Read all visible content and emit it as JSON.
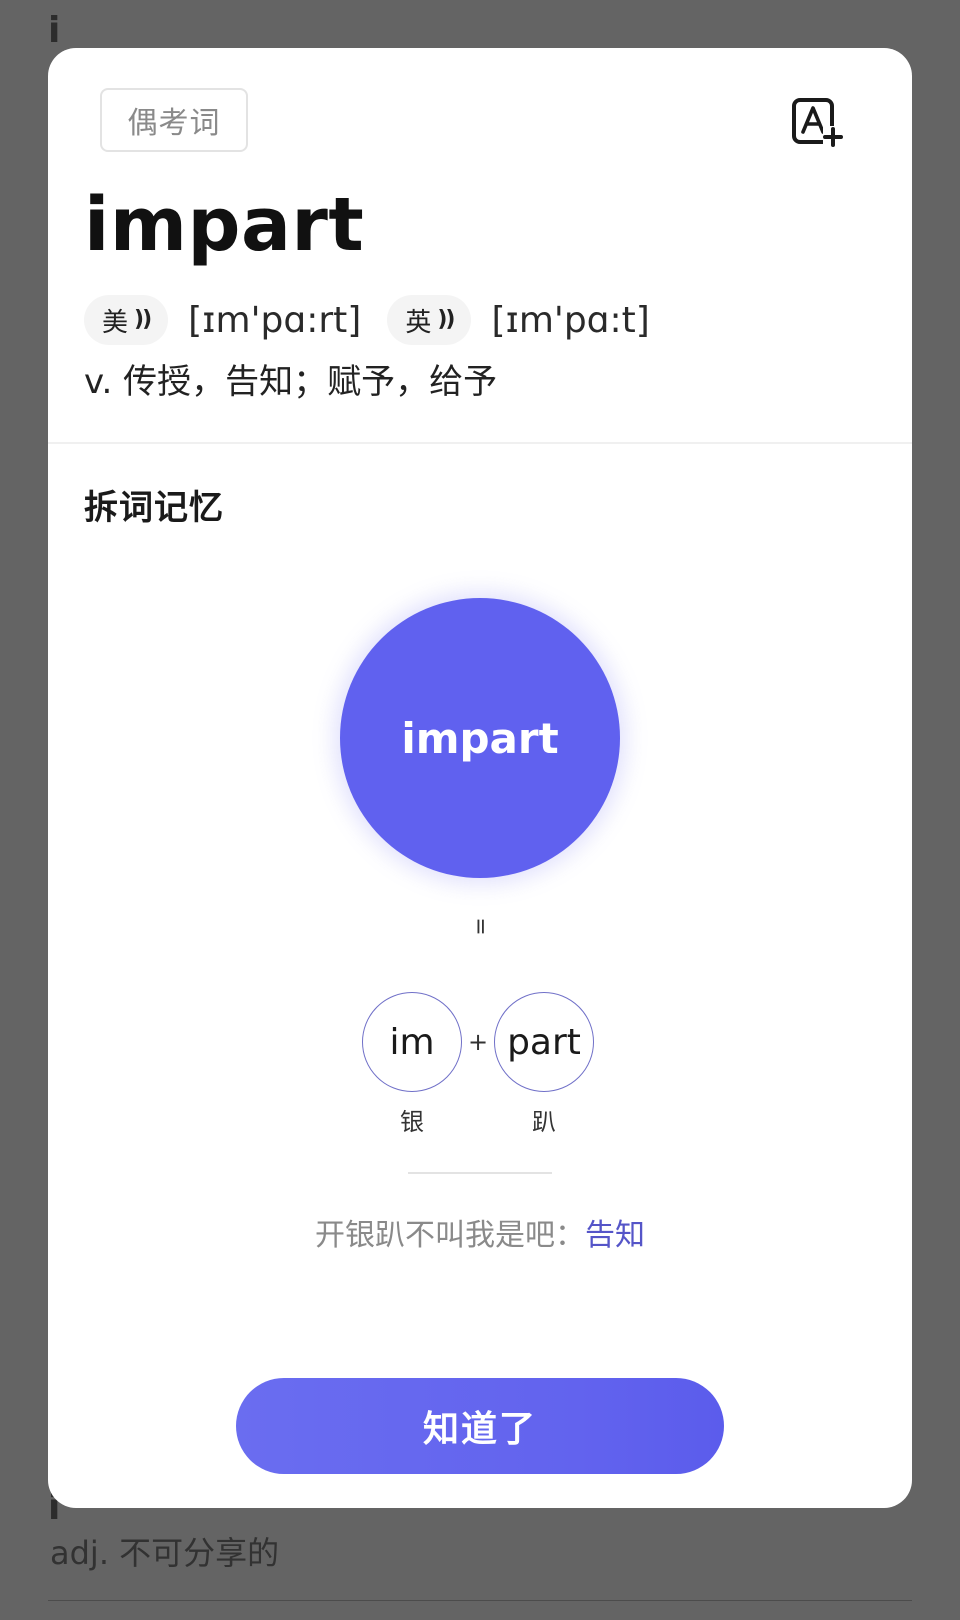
{
  "background": {
    "top_word": "i",
    "bottom_word": "i",
    "bottom_definition": "adj. 不可分享的"
  },
  "card": {
    "tag": "偶考词",
    "add_icon": "add-to-wordbook-icon",
    "word": "impart",
    "pronunciations": [
      {
        "label": "美",
        "phonetic": "[ɪm'pɑ:rt]"
      },
      {
        "label": "英",
        "phonetic": "[ɪm'pɑ:t]"
      }
    ],
    "definition": "v. 传授，告知；赋予，给予",
    "section_title": "拆词记忆",
    "split": {
      "whole": "impart",
      "equals": "=",
      "plus": "+",
      "parts": [
        {
          "text": "im",
          "meaning": "银"
        },
        {
          "text": "part",
          "meaning": "趴"
        }
      ]
    },
    "mnemonic": {
      "text": "开银趴不叫我是吧：",
      "highlight": "告知"
    },
    "confirm_button": "知道了"
  },
  "colors": {
    "accent": "#6061ef",
    "highlight": "#5555c8",
    "overlay": "#646464"
  }
}
